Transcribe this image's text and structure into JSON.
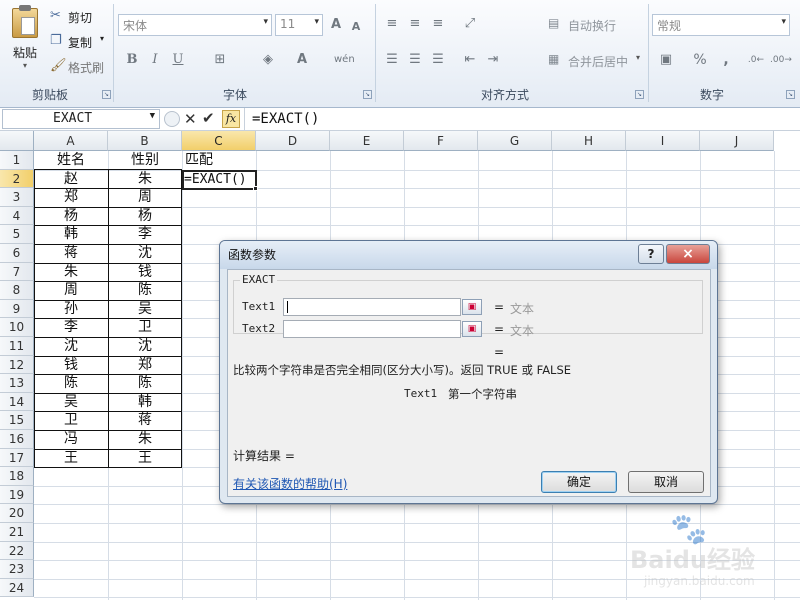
{
  "ribbon": {
    "clipboard": {
      "paste": "粘贴",
      "cut": "剪切",
      "copy": "复制",
      "format_painter": "格式刷",
      "group": "剪贴板"
    },
    "font": {
      "name": "宋体",
      "size": "11",
      "bold": "B",
      "italic": "I",
      "underline": "U",
      "grow": "A",
      "shrink": "A",
      "color_a": "A",
      "wen": "wén",
      "group": "字体"
    },
    "align": {
      "wrap": "自动换行",
      "merge": "合并后居中",
      "group": "对齐方式"
    },
    "number": {
      "format": "常规",
      "percent": "%",
      "comma": ",",
      "group": "数字"
    }
  },
  "formula_bar": {
    "name_box": "EXACT",
    "content": "=EXACT()",
    "fx": "fx"
  },
  "columns": [
    "A",
    "B",
    "C",
    "D",
    "E",
    "F",
    "G",
    "H",
    "I",
    "J"
  ],
  "rows": [
    "1",
    "2",
    "3",
    "4",
    "5",
    "6",
    "7",
    "8",
    "9",
    "10",
    "11",
    "12",
    "13",
    "14",
    "15",
    "16",
    "17",
    "18",
    "19",
    "20",
    "21",
    "22",
    "23",
    "24"
  ],
  "sheet": {
    "header": {
      "a": "姓名",
      "b": "性别",
      "c": "匹配"
    },
    "a_values": [
      "赵",
      "郑",
      "杨",
      "韩",
      "蒋",
      "朱",
      "周",
      "孙",
      "李",
      "沈",
      "钱",
      "陈",
      "吴",
      "卫",
      "冯",
      "王"
    ],
    "b_values": [
      "朱",
      "周",
      "杨",
      "李",
      "沈",
      "钱",
      "陈",
      "吴",
      "卫",
      "沈",
      "郑",
      "陈",
      "韩",
      "蒋",
      "朱",
      "王"
    ],
    "active_cell": "=EXACT()"
  },
  "dialog": {
    "title": "函数参数",
    "help_btn": "?",
    "close_btn": "×",
    "func": "EXACT",
    "args": [
      {
        "label": "Text1",
        "eq": "=",
        "hint": "文本"
      },
      {
        "label": "Text2",
        "eq": "=",
        "hint": "文本"
      }
    ],
    "result_eq": "=",
    "description": "比较两个字符串是否完全相同(区分大小写)。返回 TRUE 或 FALSE",
    "arg_desc_label": "Text1",
    "arg_desc": "第一个字符串",
    "calc_result": "计算结果 =",
    "help_link": "有关该函数的帮助(H)",
    "ok": "确定",
    "cancel": "取消"
  },
  "watermark": {
    "brand": "Baidu经验",
    "url": "jingyan.baidu.com"
  },
  "colors": {
    "accent": "#f2cf6a",
    "dialog_bg": "#dfe8f1",
    "close_red": "#c9463d"
  }
}
